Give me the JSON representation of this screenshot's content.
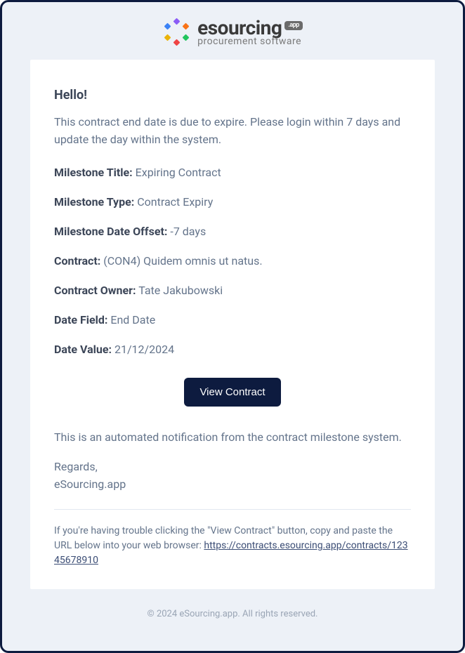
{
  "logo": {
    "brand": "esourcing",
    "badge": ".app",
    "tagline": "procurement software"
  },
  "greeting": "Hello!",
  "intro": "This contract end date is due to expire. Please login within 7 days and update the day within the system.",
  "fields": {
    "milestone_title": {
      "label": "Milestone Title:",
      "value": "Expiring Contract"
    },
    "milestone_type": {
      "label": "Milestone Type:",
      "value": "Contract Expiry"
    },
    "milestone_offset": {
      "label": "Milestone Date Offset:",
      "value": "-7 days"
    },
    "contract": {
      "label": "Contract:",
      "value": "(CON4) Quidem omnis ut natus."
    },
    "contract_owner": {
      "label": "Contract Owner:",
      "value": "Tate Jakubowski"
    },
    "date_field": {
      "label": "Date Field:",
      "value": "End Date"
    },
    "date_value": {
      "label": "Date Value:",
      "value": "21/12/2024"
    }
  },
  "button": {
    "label": "View Contract"
  },
  "automated_note": "This is an automated notification from the contract milestone system.",
  "signoff": {
    "regards": "Regards,",
    "sender": "eSourcing.app"
  },
  "trouble": {
    "text_before": "If you're having trouble clicking the \"View Contract\" button, copy and paste the URL below into your web browser: ",
    "url": "https://contracts.esourcing.app/contracts/12345678910"
  },
  "copyright": "© 2024 eSourcing.app. All rights reserved."
}
